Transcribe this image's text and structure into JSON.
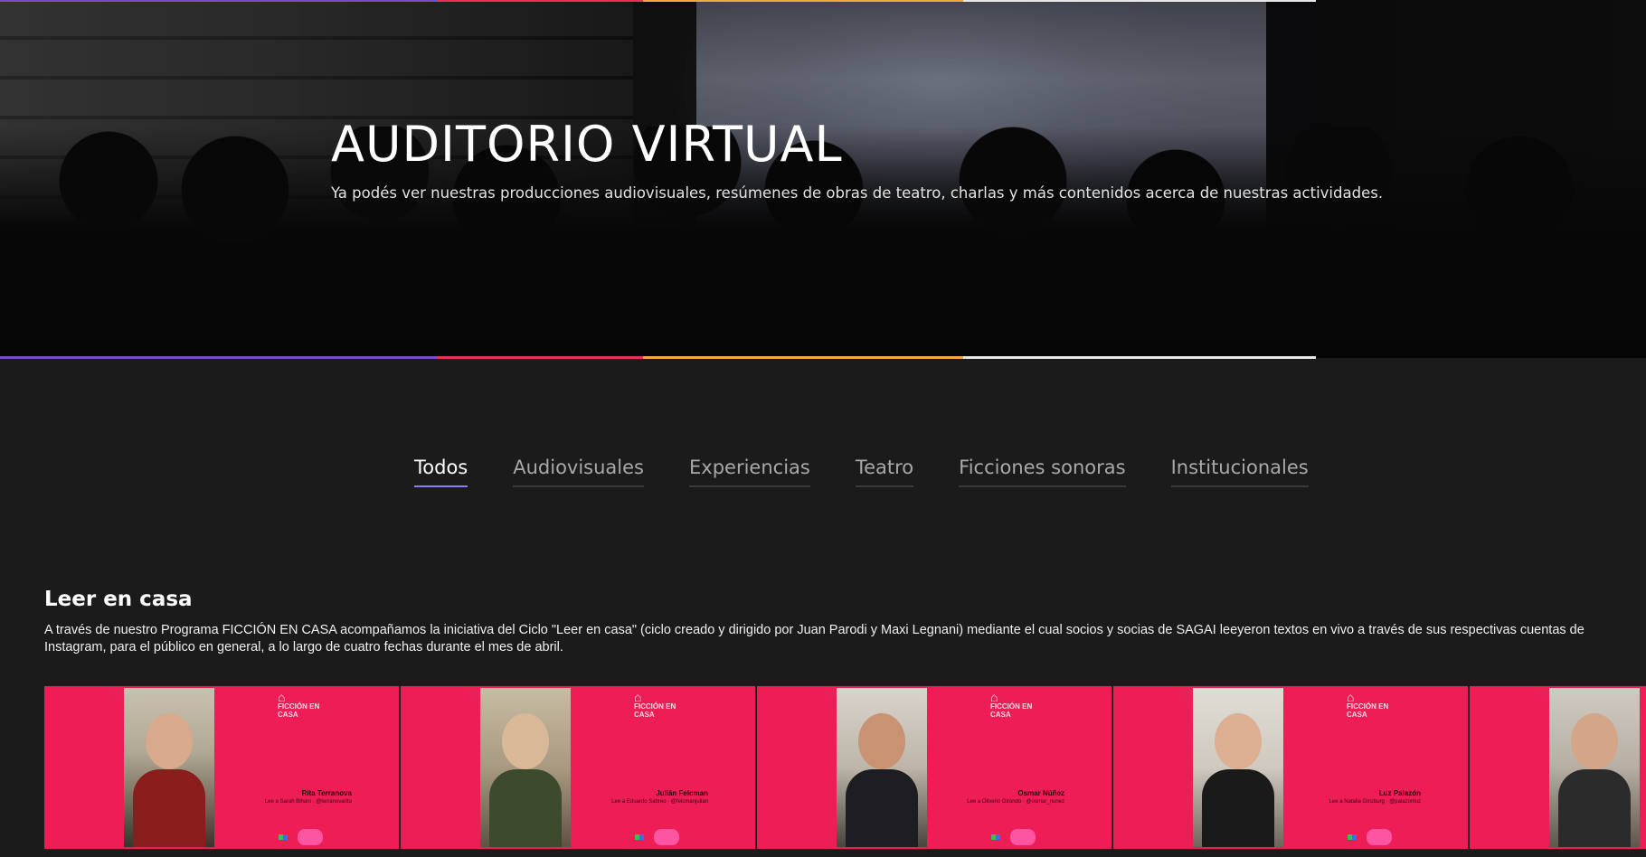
{
  "hero": {
    "title": "AUDITORIO VIRTUAL",
    "subtitle": "Ya podés ver nuestras producciones audiovisuales, resúmenes de obras de teatro, charlas y más contenidos acerca de nuestras actividades."
  },
  "colors": {
    "accent_tab": "#8a7cff",
    "card_bg": "#ee1d55",
    "page_bg": "#1b1b1c",
    "bar_segments": [
      "#7a4cc9",
      "#e8315a",
      "#f2a93a",
      "#e8e8e8"
    ]
  },
  "tabs": [
    {
      "label": "Todos",
      "active": true
    },
    {
      "label": "Audiovisuales",
      "active": false
    },
    {
      "label": "Experiencias",
      "active": false
    },
    {
      "label": "Teatro",
      "active": false
    },
    {
      "label": "Ficciones sonoras",
      "active": false
    },
    {
      "label": "Institucionales",
      "active": false
    }
  ],
  "section": {
    "title": "Leer en casa",
    "description": "A través de nuestro Programa FICCIÓN EN CASA acompañamos la iniciativa del Ciclo \"Leer en casa\" (ciclo creado y dirigido por Juan Parodi y Maxi Legnani) mediante el cual socios y socias de SAGAI leeyeron textos en vivo a través de sus respectivas cuentas de Instagram, para el público en general, a lo largo de cuatro fechas durante el mes de abril."
  },
  "cards": [
    {
      "name": "Rita Terranova",
      "sub": "Lee a Sarah Bihani · @terranovarita",
      "logo": "FICCIÓN EN CASA"
    },
    {
      "name": "Julián Felcman",
      "sub": "Lee a Eduardo Sabreo · @felcmanjulian",
      "logo": "FICCIÓN EN CASA"
    },
    {
      "name": "Osmar Núñez",
      "sub": "Lee a Oliverio Girondo · @osmar_nunez",
      "logo": "FICCIÓN EN CASA"
    },
    {
      "name": "Luz Palazón",
      "sub": "Lee a Natalia Ginzburg · @palazonluz",
      "logo": "FICCIÓN EN CASA"
    },
    {
      "name": "",
      "sub": "",
      "logo": ""
    }
  ]
}
